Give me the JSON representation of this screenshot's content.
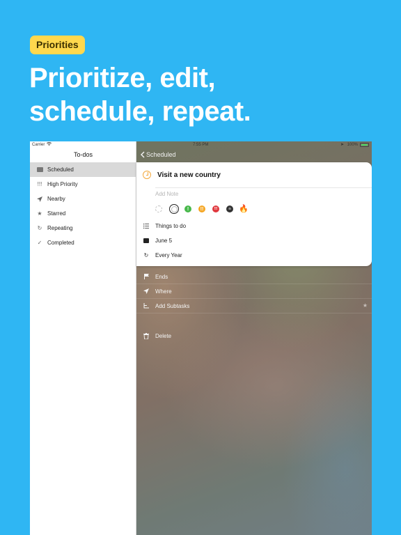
{
  "badge": "Priorities",
  "headline": [
    "Prioritize, edit,",
    "schedule, repeat."
  ],
  "status_bar": {
    "carrier": "Carrier",
    "time": "7:55 PM",
    "battery": "100%"
  },
  "sidebar": {
    "title": "To-dos",
    "items": [
      {
        "label": "Scheduled",
        "icon": "calendar-icon",
        "active": true
      },
      {
        "label": "High Priority",
        "icon": "exclamation-icon"
      },
      {
        "label": "Nearby",
        "icon": "location-arrow-icon"
      },
      {
        "label": "Starred",
        "icon": "star-icon"
      },
      {
        "label": "Repeating",
        "icon": "repeat-icon"
      },
      {
        "label": "Completed",
        "icon": "checkmark-icon"
      }
    ]
  },
  "detail": {
    "back_label": "Scheduled",
    "task_name": "Visit a new country",
    "note_placeholder": "Add Note",
    "priority_options": [
      {
        "name": "none",
        "glyph": ""
      },
      {
        "name": "selected-none",
        "glyph": ""
      },
      {
        "name": "green",
        "glyph": "!"
      },
      {
        "name": "orange",
        "glyph": "!!"
      },
      {
        "name": "red",
        "glyph": "!!!"
      },
      {
        "name": "black",
        "glyph": "☠"
      },
      {
        "name": "fire",
        "glyph": "🔥"
      }
    ],
    "list_label": "Things to do",
    "date_label": "June 5",
    "repeat_label": "Every Year",
    "rows": [
      {
        "label": "Ends",
        "icon": "flag-icon"
      },
      {
        "label": "Where",
        "icon": "location-arrow-icon"
      },
      {
        "label": "Add Subtasks",
        "icon": "subtasks-icon"
      }
    ],
    "delete_label": "Delete"
  },
  "colors": {
    "background": "#2fb6f3",
    "badge": "#ffd84d",
    "accent_orange": "#f3a73a"
  }
}
